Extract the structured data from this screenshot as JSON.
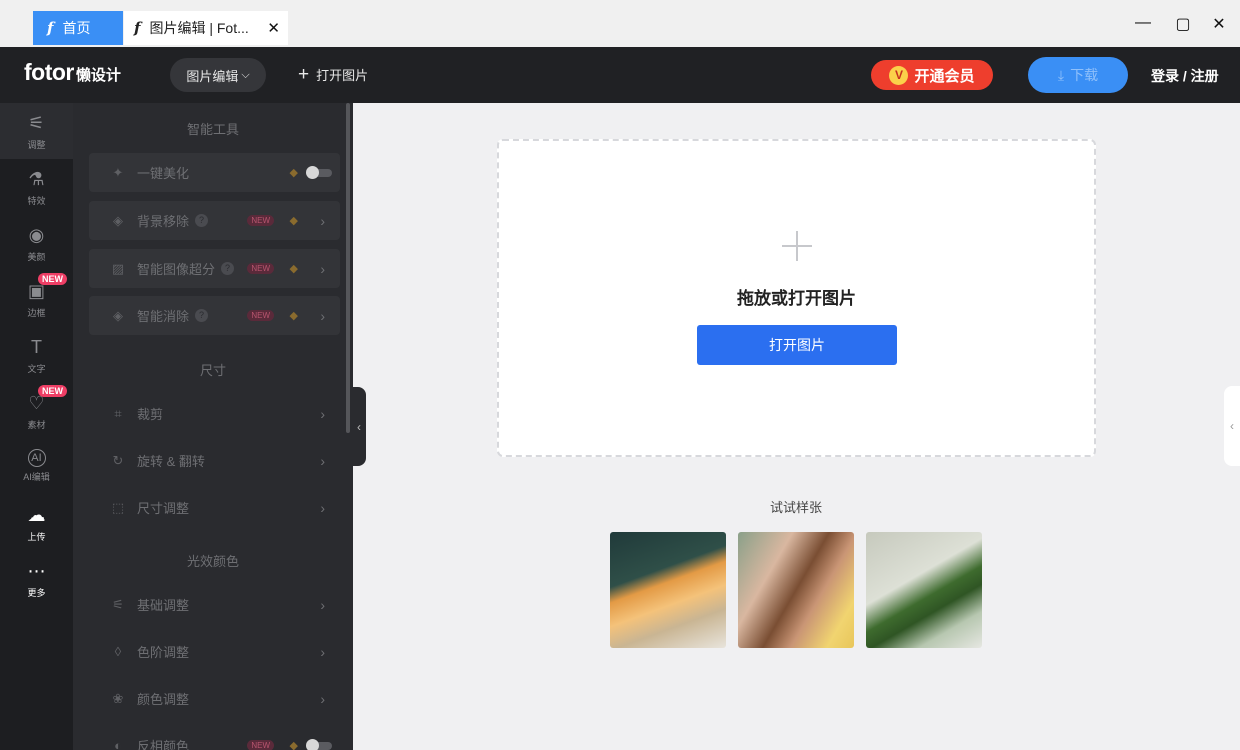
{
  "tabs": [
    {
      "label": "首页"
    },
    {
      "label": "图片编辑 | Fot..."
    }
  ],
  "window_controls": {
    "minimize": "—",
    "maximize": "▢",
    "close": "✕"
  },
  "header": {
    "logo_brand": "fotor",
    "logo_sub": "懒设计",
    "menu_label": "图片编辑",
    "open_label": "打开图片",
    "vip_label": "开通会员",
    "download_label": "下载",
    "login_label": "登录 / 注册"
  },
  "rail": {
    "items": [
      {
        "label": "调整",
        "icon": "sliders-icon"
      },
      {
        "label": "特效",
        "icon": "flask-icon"
      },
      {
        "label": "美颜",
        "icon": "eye-icon"
      },
      {
        "label": "边框",
        "icon": "frame-icon",
        "badge": "NEW"
      },
      {
        "label": "文字",
        "icon": "text-icon"
      },
      {
        "label": "素材",
        "icon": "shapes-icon",
        "badge": "NEW"
      },
      {
        "label": "AI编辑",
        "icon": "ai-icon"
      },
      {
        "label": "上传",
        "icon": "cloud-upload-icon"
      },
      {
        "label": "更多",
        "icon": "more-icon"
      }
    ]
  },
  "panel": {
    "sections": [
      {
        "title": "智能工具"
      },
      {
        "title": "尺寸"
      },
      {
        "title": "光效颜色"
      }
    ],
    "tools": [
      {
        "label": "一键美化"
      },
      {
        "label": "背景移除",
        "badge": "NEW"
      },
      {
        "label": "智能图像超分",
        "badge": "NEW"
      },
      {
        "label": "智能消除",
        "badge": "NEW"
      },
      {
        "label": "裁剪"
      },
      {
        "label": "旋转 & 翻转"
      },
      {
        "label": "尺寸调整"
      },
      {
        "label": "基础调整"
      },
      {
        "label": "色阶调整"
      },
      {
        "label": "颜色调整"
      },
      {
        "label": "反相颜色",
        "badge": "NEW"
      }
    ]
  },
  "canvas": {
    "drop_text": "拖放或打开图片",
    "open_button": "打开图片",
    "try_label": "试试样张"
  },
  "colors": {
    "accent_blue": "#2b6ff0",
    "vip_red": "#ee3e2d",
    "header_bg": "#202124"
  }
}
